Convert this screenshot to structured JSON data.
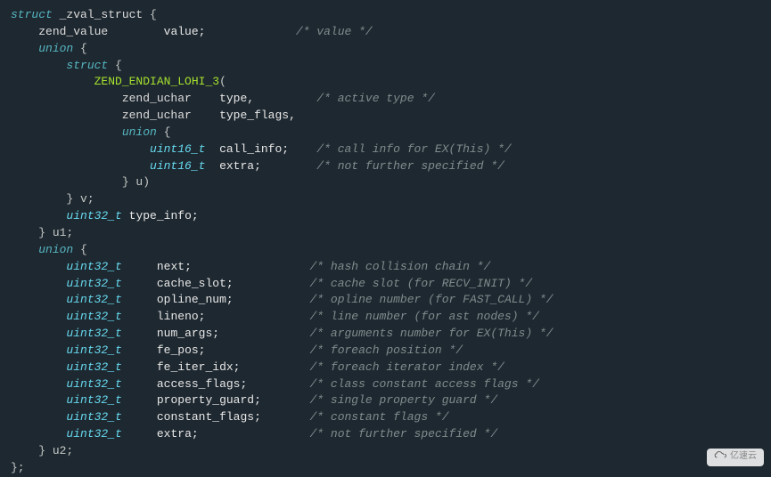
{
  "code": {
    "l1_kw1": "struct",
    "l1_name": " _zval_struct ",
    "l1_br": "{",
    "l2_indent": "    ",
    "l2_type": "zend_value",
    "l2_mid": "        ",
    "l2_field": "value;",
    "l2_space": "             ",
    "l2_cmt": "/* value */",
    "l3_indent": "    ",
    "l3_kw": "union",
    "l3_br": " {",
    "l4_indent": "        ",
    "l4_kw": "struct",
    "l4_br": " {",
    "l5_indent": "            ",
    "l5_macro": "ZEND_ENDIAN_LOHI_3",
    "l5_paren": "(",
    "l6_indent": "                ",
    "l6_type": "zend_uchar",
    "l6_mid": "    ",
    "l6_field": "type,",
    "l6_space": "         ",
    "l6_cmt": "/* active type */",
    "l7_indent": "                ",
    "l7_type": "zend_uchar",
    "l7_mid": "    ",
    "l7_field": "type_flags,",
    "l8_indent": "                ",
    "l8_kw": "union",
    "l8_br": " {",
    "l9_indent": "                    ",
    "l9_type": "uint16_t",
    "l9_mid": "  ",
    "l9_field": "call_info;",
    "l9_space": "    ",
    "l9_cmt": "/* call info for EX(This) */",
    "l10_indent": "                    ",
    "l10_type": "uint16_t",
    "l10_mid": "  ",
    "l10_field": "extra;",
    "l10_space": "        ",
    "l10_cmt": "/* not further specified */",
    "l11_indent": "                ",
    "l11_text": "} u)",
    "l12_indent": "        ",
    "l12_text": "} v;",
    "l13_indent": "        ",
    "l13_type": "uint32_t",
    "l13_mid": " ",
    "l13_field": "type_info;",
    "l14_indent": "    ",
    "l14_text": "} u1;",
    "l15_indent": "    ",
    "l15_kw": "union",
    "l15_br": " {",
    "l16_indent": "        ",
    "l16_type": "uint32_t",
    "l16_mid": "     ",
    "l16_field": "next;",
    "l16_space": "                 ",
    "l16_cmt": "/* hash collision chain */",
    "l17_indent": "        ",
    "l17_type": "uint32_t",
    "l17_mid": "     ",
    "l17_field": "cache_slot;",
    "l17_space": "           ",
    "l17_cmt": "/* cache slot (for RECV_INIT) */",
    "l18_indent": "        ",
    "l18_type": "uint32_t",
    "l18_mid": "     ",
    "l18_field": "opline_num;",
    "l18_space": "           ",
    "l18_cmt": "/* opline number (for FAST_CALL) */",
    "l19_indent": "        ",
    "l19_type": "uint32_t",
    "l19_mid": "     ",
    "l19_field": "lineno;",
    "l19_space": "               ",
    "l19_cmt": "/* line number (for ast nodes) */",
    "l20_indent": "        ",
    "l20_type": "uint32_t",
    "l20_mid": "     ",
    "l20_field": "num_args;",
    "l20_space": "             ",
    "l20_cmt": "/* arguments number for EX(This) */",
    "l21_indent": "        ",
    "l21_type": "uint32_t",
    "l21_mid": "     ",
    "l21_field": "fe_pos;",
    "l21_space": "               ",
    "l21_cmt": "/* foreach position */",
    "l22_indent": "        ",
    "l22_type": "uint32_t",
    "l22_mid": "     ",
    "l22_field": "fe_iter_idx;",
    "l22_space": "          ",
    "l22_cmt": "/* foreach iterator index */",
    "l23_indent": "        ",
    "l23_type": "uint32_t",
    "l23_mid": "     ",
    "l23_field": "access_flags;",
    "l23_space": "         ",
    "l23_cmt": "/* class constant access flags */",
    "l24_indent": "        ",
    "l24_type": "uint32_t",
    "l24_mid": "     ",
    "l24_field": "property_guard;",
    "l24_space": "       ",
    "l24_cmt": "/* single property guard */",
    "l25_indent": "        ",
    "l25_type": "uint32_t",
    "l25_mid": "     ",
    "l25_field": "constant_flags;",
    "l25_space": "       ",
    "l25_cmt": "/* constant flags */",
    "l26_indent": "        ",
    "l26_type": "uint32_t",
    "l26_mid": "     ",
    "l26_field": "extra;",
    "l26_space": "                ",
    "l26_cmt": "/* not further specified */",
    "l27_indent": "    ",
    "l27_text": "} u2;",
    "l28_text": "};"
  },
  "watermark": "亿速云"
}
